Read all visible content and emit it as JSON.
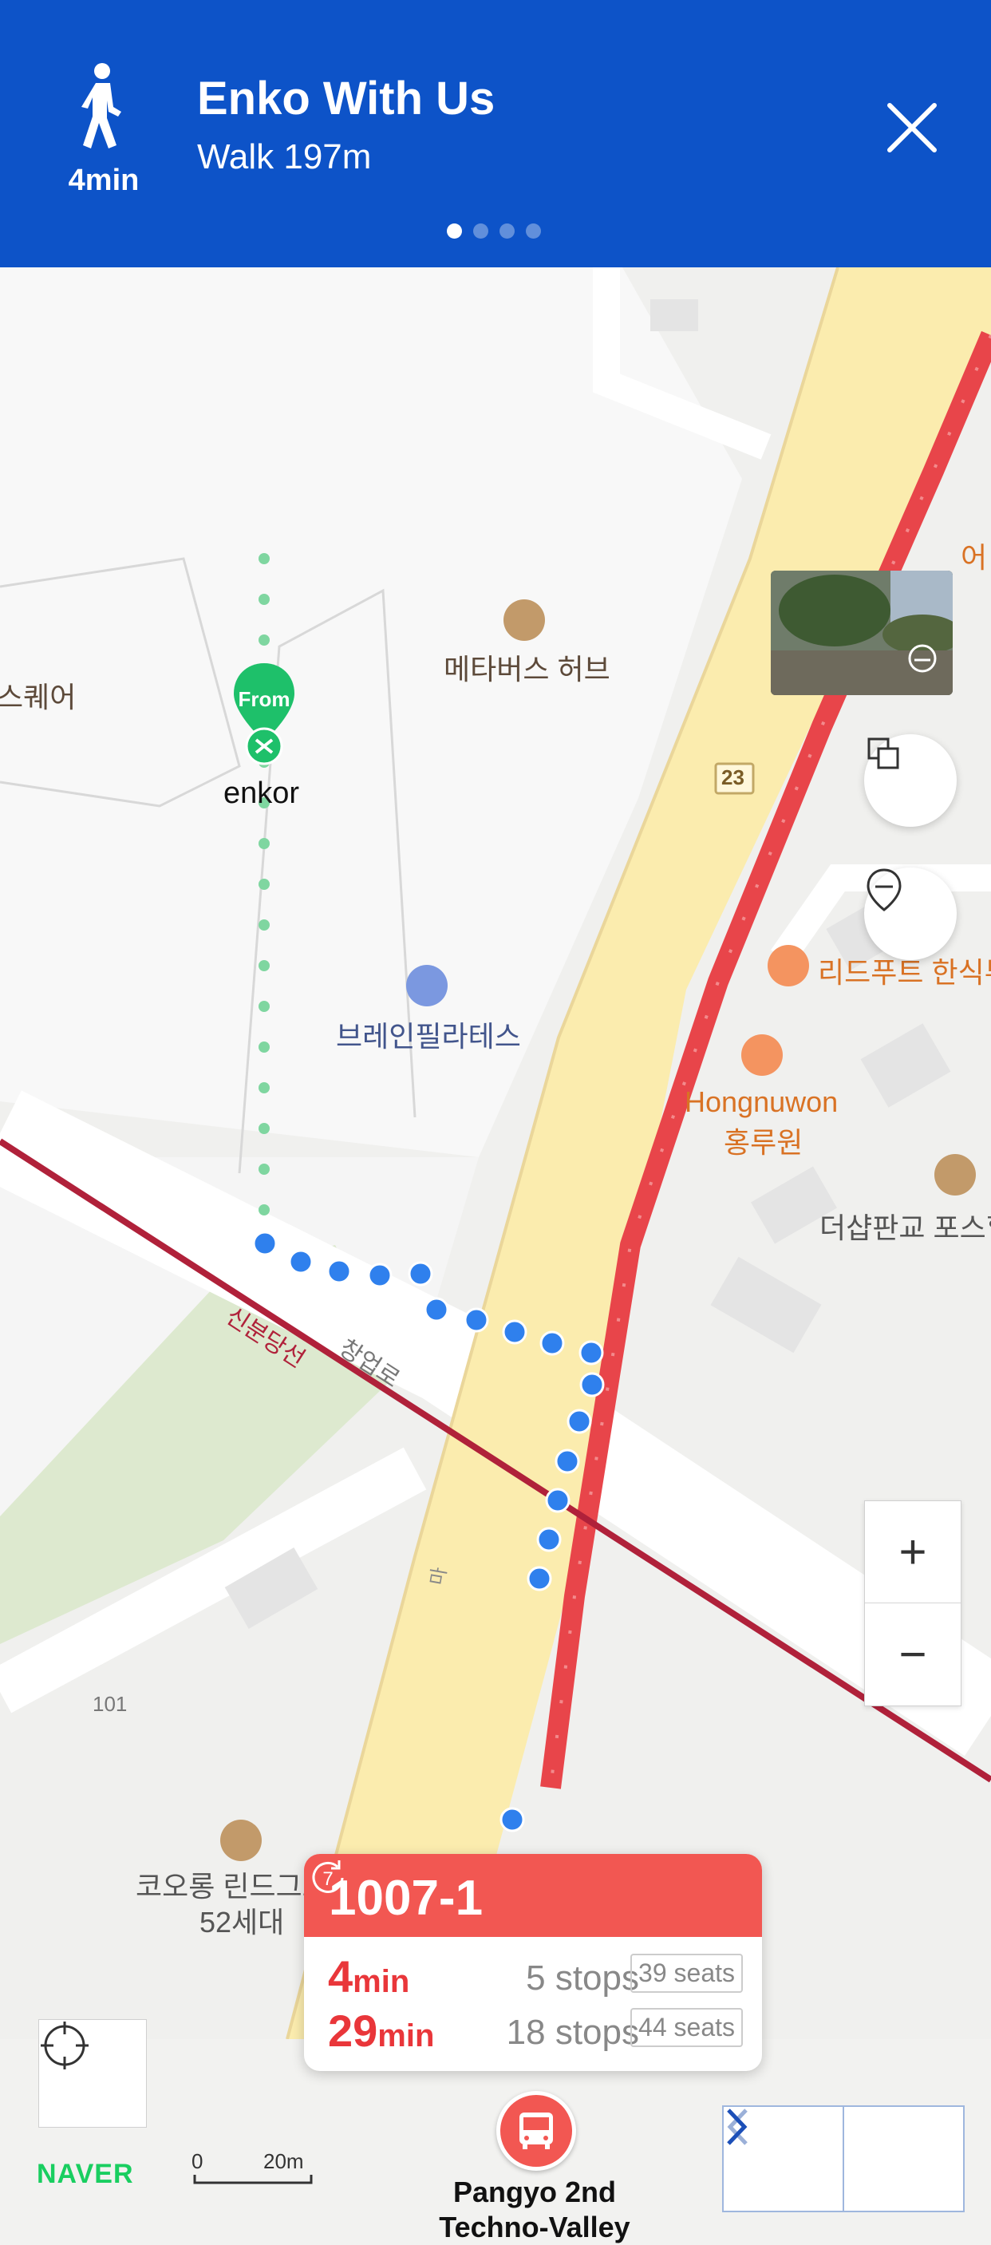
{
  "header": {
    "walk_time": "4min",
    "title": "Enko With Us",
    "subtitle": "Walk 197m",
    "page_dots": 4,
    "active_dot": 0
  },
  "map": {
    "origin_badge": "From",
    "origin_name": "enkor",
    "labels": {
      "metabus_hub": "메타버스 허브",
      "square_partial": "스퀘어",
      "brain_pilates": "브레인필라테스",
      "road_number": "23",
      "leedfoot": "리드푸트 한식부",
      "hongnuwon_en": "Hongnuwon",
      "hongnuwon_ko": "홍루원",
      "the_sharp": "더샵판교 포스힐",
      "line_name": "신분당선",
      "street_name": "창업로",
      "partial_top_right": "어",
      "kolon_line1": "코오롱 린드그로브",
      "kolon_line2": "52세대",
      "road_101": "101",
      "street_small": "마"
    },
    "scale": {
      "zero": "0",
      "distance": "20m"
    },
    "brand": "NAVER",
    "icons": {
      "walk": "walk-icon",
      "close": "close-icon",
      "layers": "layers-icon",
      "location_pin": "location-pin-icon",
      "zoom_in": "plus-icon",
      "zoom_out": "minus-icon",
      "my_location": "crosshair-icon",
      "prev": "chevron-left-icon",
      "next": "chevron-right-icon",
      "bus": "bus-icon",
      "refresh": "refresh-icon"
    }
  },
  "bus_card": {
    "number": "1007-1",
    "refresh_count": "7",
    "arrivals": [
      {
        "min_value": "4",
        "min_unit": "min",
        "stops": "5 stops",
        "seats": "39 seats"
      },
      {
        "min_value": "29",
        "min_unit": "min",
        "stops": "18 stops",
        "seats": "44 seats"
      }
    ]
  },
  "stop": {
    "line1": "Pangyo 2nd",
    "line2": "Techno-Valley"
  },
  "colors": {
    "header_bg": "#0d53c8",
    "bus_red": "#f25752",
    "walk_green": "#7fd6a0",
    "walk_blue": "#2f80ed",
    "subway_line": "#b0213a",
    "road_yellow": "#fbecae"
  }
}
